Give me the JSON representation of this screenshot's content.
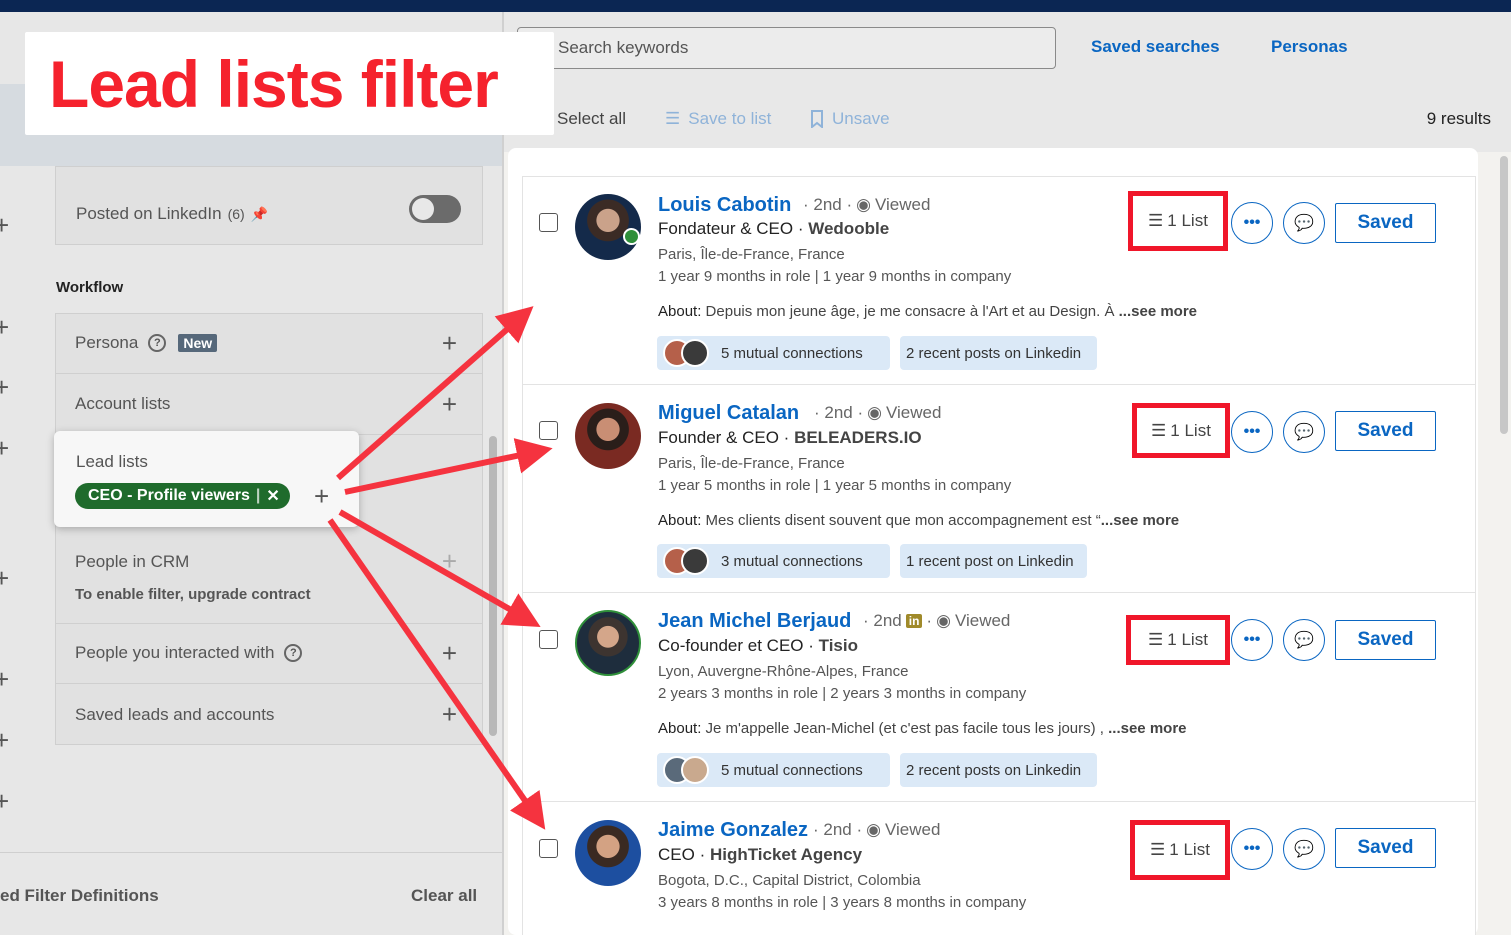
{
  "overlay_title": "Lead lists filter",
  "search": {
    "placeholder": "Search keywords"
  },
  "top_links": {
    "saved_searches": "Saved searches",
    "personas": "Personas"
  },
  "toolbar": {
    "select_all": "Select all",
    "save_to_list": "Save to list",
    "unsave": "Unsave",
    "results": "9 results"
  },
  "filters": {
    "posted_on_linkedin": "Posted on LinkedIn",
    "posted_count": "(6)",
    "workflow_label": "Workflow",
    "persona": "Persona",
    "new_badge": "New",
    "account_lists": "Account lists",
    "lead_lists": "Lead lists",
    "lead_list_pill": "CEO - Profile viewers",
    "people_in_crm": "People in CRM",
    "crm_note": "To enable filter, upgrade contract",
    "people_interacted": "People you interacted with",
    "saved_leads": "Saved leads and accounts"
  },
  "footer": {
    "definitions": "ed Filter Definitions",
    "clear_all": "Clear all"
  },
  "colors": {
    "accent": "#0a66c2",
    "highlight": "#f0162a",
    "pill": "#1f6b2c"
  },
  "leads": [
    {
      "name": "Louis Cabotin",
      "degree": "· 2nd ·",
      "viewed": "Viewed",
      "role": "Fondateur & CEO",
      "company": "Wedooble",
      "location": "Paris, Île-de-France, France",
      "tenure": "1 year 9 months in role | 1 year 9 months in company",
      "about_label": "About:",
      "about": "Depuis mon jeune âge, je me consacre à l'Art et au Design. À",
      "see_more": "...see more",
      "mutual": "5 mutual connections",
      "posts": "2 recent posts on Linkedin",
      "list": "1 List",
      "saved": "Saved"
    },
    {
      "name": "Miguel Catalan",
      "degree": "· 2nd ·",
      "viewed": "Viewed",
      "role": "Founder & CEO",
      "company": "BELEADERS.IO",
      "location": "Paris, Île-de-France, France",
      "tenure": "1 year 5 months in role | 1 year 5 months in company",
      "about_label": "About:",
      "about": "Mes clients disent souvent que mon accompagnement est “",
      "see_more": "...see more",
      "mutual": "3 mutual connections",
      "posts": "1 recent post on Linkedin",
      "list": "1 List",
      "saved": "Saved"
    },
    {
      "name": "Jean Michel Berjaud",
      "degree": "· 2nd",
      "viewed": "Viewed",
      "role": "Co-founder et CEO",
      "company": "Tisio",
      "location": "Lyon, Auvergne-Rhône-Alpes, France",
      "tenure": "2 years 3 months in role | 2 years 3 months in company",
      "about_label": "About:",
      "about": "Je m'appelle Jean-Michel (et c'est pas facile tous les jours) ,",
      "see_more": "...see more",
      "mutual": "5 mutual connections",
      "posts": "2 recent posts on Linkedin",
      "list": "1 List",
      "saved": "Saved"
    },
    {
      "name": "Jaime Gonzalez",
      "degree": "· 2nd ·",
      "viewed": "Viewed",
      "role": "CEO",
      "company": "HighTicket Agency",
      "location": "Bogota, D.C., Capital District, Colombia",
      "tenure": "3 years 8 months in role | 3 years 8 months in company",
      "list": "1 List",
      "saved": "Saved"
    }
  ]
}
